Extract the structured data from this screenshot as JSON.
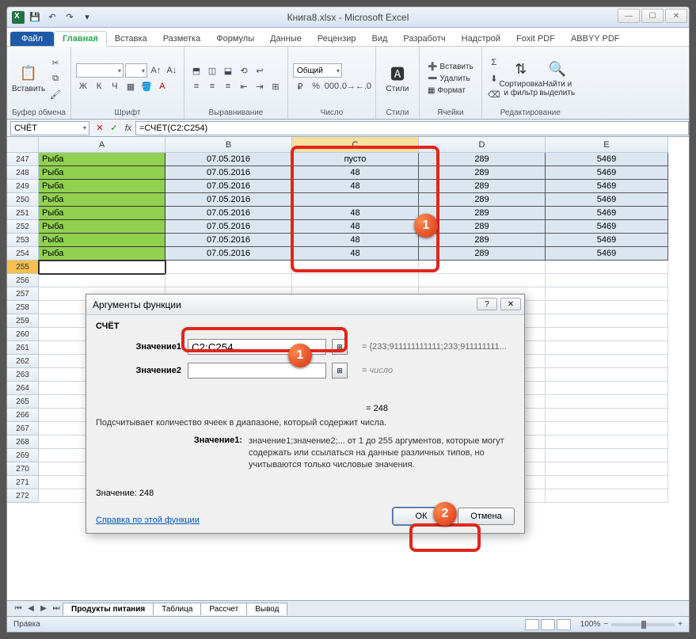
{
  "title": "Книга8.xlsx - Microsoft Excel",
  "tabs": {
    "file": "Файл",
    "list": [
      "Главная",
      "Вставка",
      "Разметка",
      "Формулы",
      "Данные",
      "Рецензир",
      "Вид",
      "Разработч",
      "Надстрой",
      "Foxit PDF",
      "ABBYY PDF"
    ],
    "active": "Главная"
  },
  "ribbon": {
    "clipboard": {
      "paste": "Вставить",
      "label": "Буфер обмена"
    },
    "font": {
      "label": "Шрифт",
      "bold": "Ж",
      "italic": "К",
      "underline": "Ч"
    },
    "align": {
      "label": "Выравнивание"
    },
    "number": {
      "combo": "Общий",
      "label": "Число"
    },
    "styles": {
      "btn": "Стили",
      "label": "Стили"
    },
    "cells": {
      "insert": "Вставить",
      "delete": "Удалить",
      "format": "Формат",
      "label": "Ячейки"
    },
    "editing": {
      "sort": "Сортировка и фильтр",
      "find": "Найти и выделить",
      "label": "Редактирование"
    }
  },
  "formula": {
    "name": "СЧЁТ",
    "value": "=СЧЁТ(C2:C254)"
  },
  "columns": [
    "A",
    "B",
    "C",
    "D",
    "E"
  ],
  "rows": [
    {
      "n": 247,
      "a": "Рыба",
      "b": "07.05.2016",
      "c": "пусто",
      "d": "289",
      "e": "5469"
    },
    {
      "n": 248,
      "a": "Рыба",
      "b": "07.05.2016",
      "c": "48",
      "d": "289",
      "e": "5469"
    },
    {
      "n": 249,
      "a": "Рыба",
      "b": "07.05.2016",
      "c": "48",
      "d": "289",
      "e": "5469"
    },
    {
      "n": 250,
      "a": "Рыба",
      "b": "07.05.2016",
      "c": "",
      "d": "289",
      "e": "5469"
    },
    {
      "n": 251,
      "a": "Рыба",
      "b": "07.05.2016",
      "c": "48",
      "d": "289",
      "e": "5469"
    },
    {
      "n": 252,
      "a": "Рыба",
      "b": "07.05.2016",
      "c": "48",
      "d": "289",
      "e": "5469"
    },
    {
      "n": 253,
      "a": "Рыба",
      "b": "07.05.2016",
      "c": "48",
      "d": "289",
      "e": "5469"
    },
    {
      "n": 254,
      "a": "Рыба",
      "b": "07.05.2016",
      "c": "48",
      "d": "289",
      "e": "5469"
    }
  ],
  "empty_rows": [
    255,
    256,
    257,
    258,
    259,
    260,
    261,
    262,
    263,
    264,
    265,
    266,
    267,
    268,
    269,
    270,
    271,
    272
  ],
  "dialog": {
    "title": "Аргументы функции",
    "func": "СЧЁТ",
    "arg1_label": "Значение1",
    "arg1_value": "C2:C254",
    "arg1_preview": "= {233;911111111111;233;911111111...",
    "arg2_label": "Значение2",
    "arg2_preview_word": "число",
    "result_eq": "= 248",
    "desc": "Подсчитывает количество ячеек в диапазоне, который содержит числа.",
    "detail_label": "Значение1:",
    "detail_text": "значение1;значение2;... от 1 до 255 аргументов, которые могут содержать или ссылаться на данные различных типов, но учитываются только числовые значения.",
    "value_label": "Значение:",
    "value_num": "248",
    "help": "Справка по этой функции",
    "ok": "ОК",
    "cancel": "Отмена"
  },
  "sheets": {
    "active": "Продукты питания",
    "others": [
      "Таблица",
      "Рассчет",
      "Вывод"
    ]
  },
  "status": {
    "mode": "Правка",
    "zoom": "100%"
  }
}
